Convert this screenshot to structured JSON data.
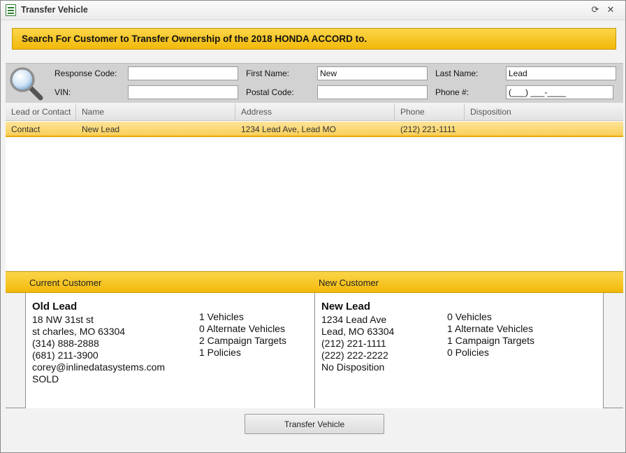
{
  "window": {
    "title": "Transfer Vehicle"
  },
  "banner": {
    "text": "Search For Customer to Transfer Ownership of the 2018 HONDA ACCORD to."
  },
  "search": {
    "response_code_label": "Response Code:",
    "response_code_value": "",
    "first_name_label": "First Name:",
    "first_name_value": "New",
    "last_name_label": "Last Name:",
    "last_name_value": "Lead",
    "vin_label": "VIN:",
    "vin_value": "",
    "postal_code_label": "Postal Code:",
    "postal_code_value": "",
    "phone_label": "Phone #:",
    "phone_value": "(___) ___-____"
  },
  "grid": {
    "columns": [
      "Lead or Contact",
      "Name",
      "Address",
      "Phone",
      "Disposition"
    ],
    "rows": [
      {
        "type": "Contact",
        "name": "New Lead",
        "address": "1234 Lead Ave, Lead MO",
        "phone": "(212) 221-1111",
        "disposition": ""
      }
    ]
  },
  "current_customer": {
    "header": "Current Customer",
    "name": "Old Lead",
    "lines": [
      "18 NW 31st st",
      "st charles, MO 63304",
      "(314) 888-2888",
      "(681) 211-3900",
      "corey@inlinedatasystems.com",
      "SOLD"
    ],
    "stats": [
      "1 Vehicles",
      "0 Alternate Vehicles",
      "2 Campaign Targets",
      "1 Policies"
    ]
  },
  "new_customer": {
    "header": "New Customer",
    "name": "New Lead",
    "lines": [
      "1234 Lead Ave",
      "Lead, MO 63304",
      "(212) 221-1111",
      "(222) 222-2222",
      "No Disposition"
    ],
    "stats": [
      "0 Vehicles",
      "1 Alternate Vehicles",
      "1 Campaign Targets",
      "0 Policies"
    ]
  },
  "actions": {
    "transfer_label": "Transfer Vehicle"
  },
  "icons": {
    "title": "form-icon",
    "refresh": "refresh-icon",
    "close": "close-icon",
    "search": "magnifier-icon"
  },
  "colors": {
    "accent_yellow": "#f9cf58",
    "banner_gold": "#f2b909",
    "border_gray": "#8f8f8f"
  }
}
